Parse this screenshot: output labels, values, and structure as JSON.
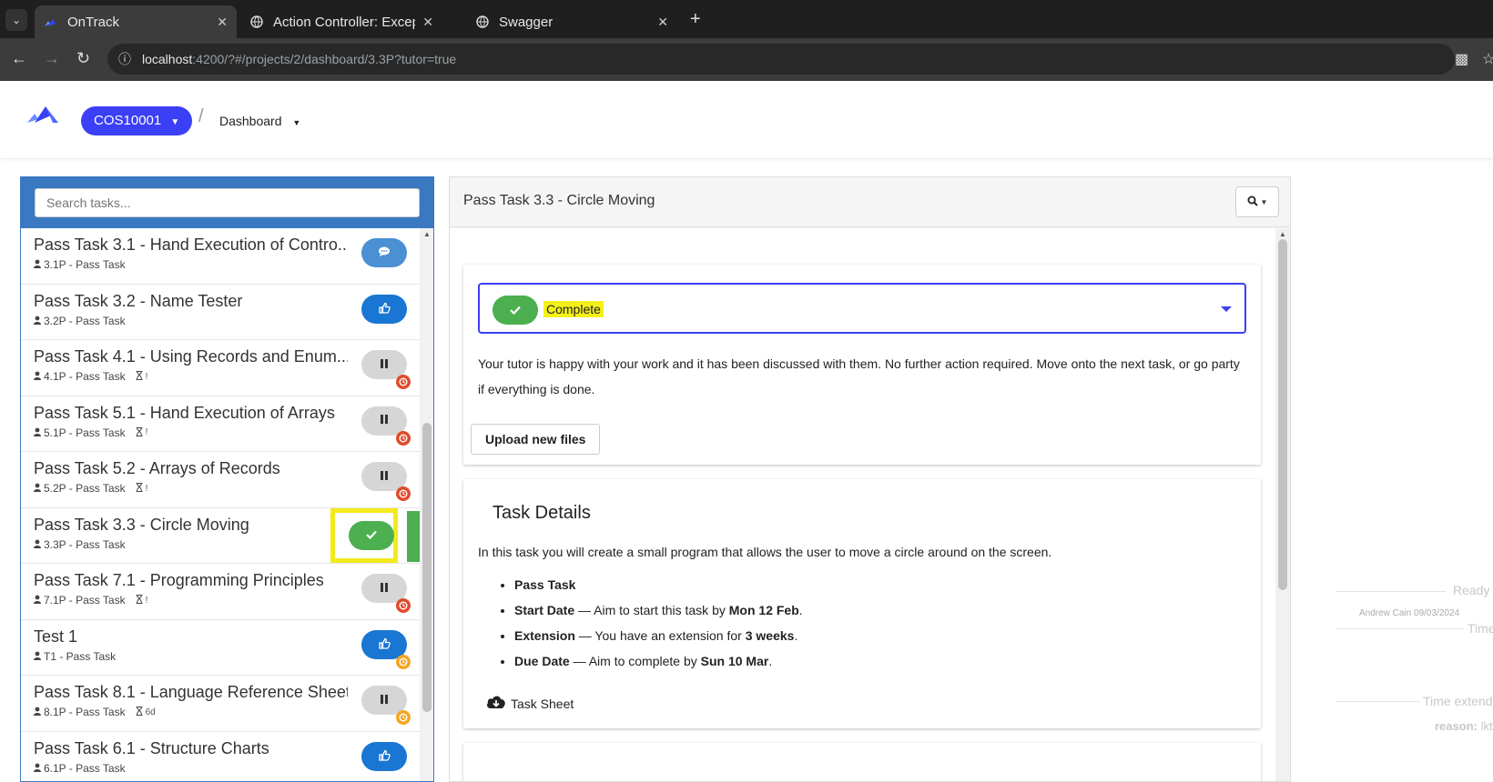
{
  "browser": {
    "tabs": [
      {
        "title": "OnTrack",
        "active": true
      },
      {
        "title": "Action Controller: Except",
        "active": false
      },
      {
        "title": "Swagger",
        "active": false
      }
    ],
    "url_host": "localhost",
    "url_rest": ":4200/?#/projects/2/dashboard/3.3P?tutor=true"
  },
  "header": {
    "unit_code": "COS10001",
    "breadcrumb_sep": "/",
    "dashboard_label": "Dashboard"
  },
  "task_list": {
    "search_placeholder": "Search tasks...",
    "tasks": [
      {
        "name": "Pass Task 3.1 - Hand Execution of Contro...",
        "sub": "3.1P - Pass Task",
        "extra": "",
        "status": "discuss",
        "badge": "",
        "selected": false
      },
      {
        "name": "Pass Task 3.2 - Name Tester",
        "sub": "3.2P - Pass Task",
        "extra": "",
        "status": "ready",
        "badge": "",
        "selected": false
      },
      {
        "name": "Pass Task 4.1 - Using Records and Enum...",
        "sub": "4.1P - Pass Task",
        "extra": "!",
        "status": "paused",
        "badge": "red",
        "selected": false
      },
      {
        "name": "Pass Task 5.1 - Hand Execution of Arrays",
        "sub": "5.1P - Pass Task",
        "extra": "!",
        "status": "paused",
        "badge": "red",
        "selected": false
      },
      {
        "name": "Pass Task 5.2 - Arrays of Records",
        "sub": "5.2P - Pass Task",
        "extra": "!",
        "status": "paused",
        "badge": "red",
        "selected": false
      },
      {
        "name": "Pass Task 3.3 - Circle Moving",
        "sub": "3.3P - Pass Task",
        "extra": "",
        "status": "complete",
        "badge": "",
        "selected": true
      },
      {
        "name": "Pass Task 7.1 - Programming Principles",
        "sub": "7.1P - Pass Task",
        "extra": "!",
        "status": "paused",
        "badge": "red",
        "selected": false
      },
      {
        "name": "Test 1",
        "sub": "T1 - Pass Task",
        "extra": "",
        "status": "ready",
        "badge": "amber",
        "selected": false
      },
      {
        "name": "Pass Task 8.1 - Language Reference Sheet",
        "sub": "8.1P - Pass Task",
        "extra": "6d",
        "status": "paused",
        "badge": "amber",
        "selected": false
      },
      {
        "name": "Pass Task 6.1 - Structure Charts",
        "sub": "6.1P - Pass Task",
        "extra": "",
        "status": "ready",
        "badge": "",
        "selected": false
      }
    ]
  },
  "detail": {
    "title": "Pass Task 3.3 - Circle Moving",
    "status_label": "Complete",
    "status_description": "Your tutor is happy with your work and it has been discussed with them. No further action required. Move onto the next task, or go party if everything is done.",
    "upload_label": "Upload new files",
    "details_heading": "Task Details",
    "details_intro": "In this task you will create a small program that allows the user to move a circle around on the screen.",
    "task_type": "Pass Task",
    "start_label": "Start Date",
    "start_text": " — Aim to start this task by ",
    "start_date": "Mon 12 Feb",
    "extension_label": "Extension",
    "extension_text": " — You have an extension for ",
    "extension_value": "3 weeks",
    "due_label": "Due Date",
    "due_text": " — Aim to complete by ",
    "due_date": "Sun 10 Mar",
    "task_sheet_label": "Task Sheet"
  },
  "timeline": {
    "ready": "Ready",
    "author": "Andrew Cain 09/03/2024",
    "time": "Time",
    "time_extend": "Time extend",
    "reason_label": "reason:",
    "reason_value": "lkt"
  },
  "colors": {
    "accent": "#3b3ff5",
    "panel_blue": "#3a78c2",
    "complete_green": "#4caf50",
    "highlight_yellow": "#f3ea1b"
  }
}
